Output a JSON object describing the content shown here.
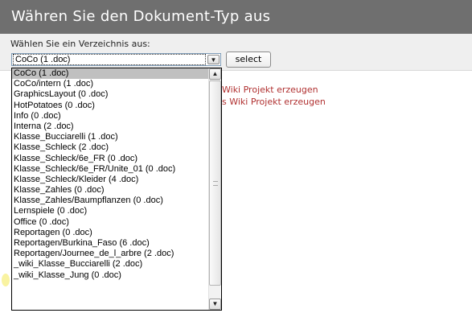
{
  "header": {
    "title": "Währen Sie den Dokument-Typ aus"
  },
  "form": {
    "label": "Wählen Sie ein Verzeichnis aus:",
    "selected_value": "CoCo (1 .doc)",
    "button_label": "select"
  },
  "links": [
    {
      "text": "Wiki Projekt erzeugen"
    },
    {
      "text": "s Wiki Projekt erzeugen"
    }
  ],
  "dropdown": {
    "options": [
      "CoCo (1 .doc)",
      "CoCo/intern (1 .doc)",
      "GraphicsLayout (0 .doc)",
      "HotPotatoes (0 .doc)",
      "Info (0 .doc)",
      "Interna (2 .doc)",
      "Klasse_Bucciarelli (1 .doc)",
      "Klasse_Schleck (2 .doc)",
      "Klasse_Schleck/6e_FR (0 .doc)",
      "Klasse_Schleck/6e_FR/Unite_01 (0 .doc)",
      "Klasse_Schleck/Kleider (4 .doc)",
      "Klasse_Zahles (0 .doc)",
      "Klasse_Zahles/Baumpflanzen (0 .doc)",
      "Lernspiele (0 .doc)",
      "Office (0 .doc)",
      "Reportagen (0 .doc)",
      "Reportagen/Burkina_Faso (6 .doc)",
      "Reportagen/Journee_de_l_arbre (2 .doc)",
      "_wiki_Klasse_Bucciarelli (2 .doc)",
      "_wiki_Klasse_Jung (0 .doc)"
    ],
    "selected_index": 0
  },
  "icons": {
    "dropdown_arrow": "chevron-down-icon",
    "scroll_up": "chevron-up-icon",
    "scroll_down": "chevron-down-icon"
  }
}
